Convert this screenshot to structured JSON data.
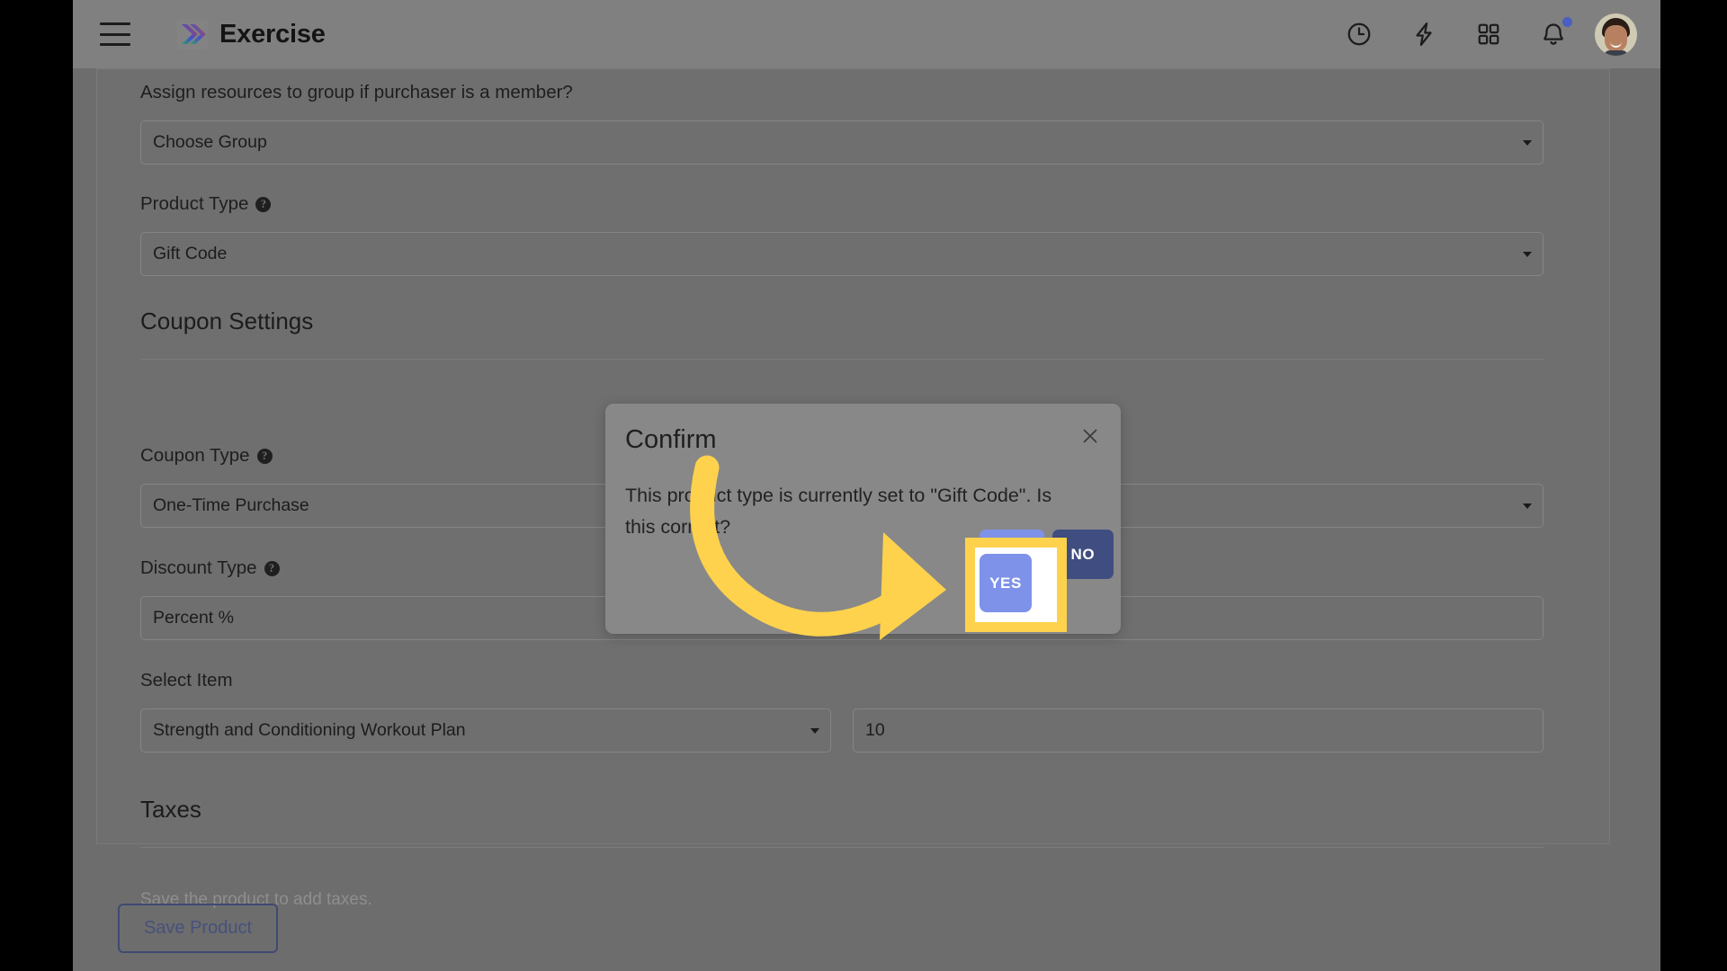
{
  "header": {
    "menu_icon": "hamburger-menu-icon",
    "brand_name": "Exercise",
    "icons": [
      {
        "name": "clock-icon",
        "label": "Recent"
      },
      {
        "name": "lightning-bolt-icon",
        "label": "Quick Actions"
      },
      {
        "name": "apps-grid-icon",
        "label": "Apps"
      },
      {
        "name": "bell-icon",
        "label": "Notifications",
        "has_dot": true
      }
    ],
    "avatar_label": "User Account"
  },
  "form": {
    "group_assign": {
      "label": "Assign resources to group if purchaser is a member?",
      "value": "Choose Group"
    },
    "product_type": {
      "label": "Product Type",
      "help": "?",
      "value": "Gift Code"
    },
    "coupon_settings_title": "Coupon Settings",
    "coupon_type": {
      "label": "Coupon Type",
      "help": "?",
      "value": "One-Time Purchase"
    },
    "discount_type": {
      "label": "Discount Type",
      "help": "?",
      "value": "Percent %"
    },
    "select_item": {
      "label": "Select Item",
      "value": "Strength and Conditioning Workout Plan"
    },
    "quantity": {
      "label_fragment": "?",
      "value": "10"
    },
    "taxes_title": "Taxes",
    "taxes_note": "Save the product to add taxes.",
    "save_button": "Save Product"
  },
  "modal": {
    "title": "Confirm",
    "close_icon": "close-x-icon",
    "message": "This product type is currently set to \"Gift Code\". Is this correct?",
    "yes_label": "YES",
    "no_label": "NO"
  },
  "annotation": {
    "highlight_target": "YES",
    "arrow_color": "#ffd24d",
    "highlight_border_color": "#ffd24d"
  },
  "colors": {
    "page_black": "#000000",
    "app_background": "#6d6d6d",
    "header_background": "#808080",
    "card_background": "#6f6f6f",
    "modal_background": "#888888",
    "yes_button": "#7d92e8",
    "no_button": "#3f4d80",
    "save_button_border": "#3f4a73",
    "notification_dot": "#4a5fc1",
    "highlight_yellow": "#ffd24d"
  }
}
